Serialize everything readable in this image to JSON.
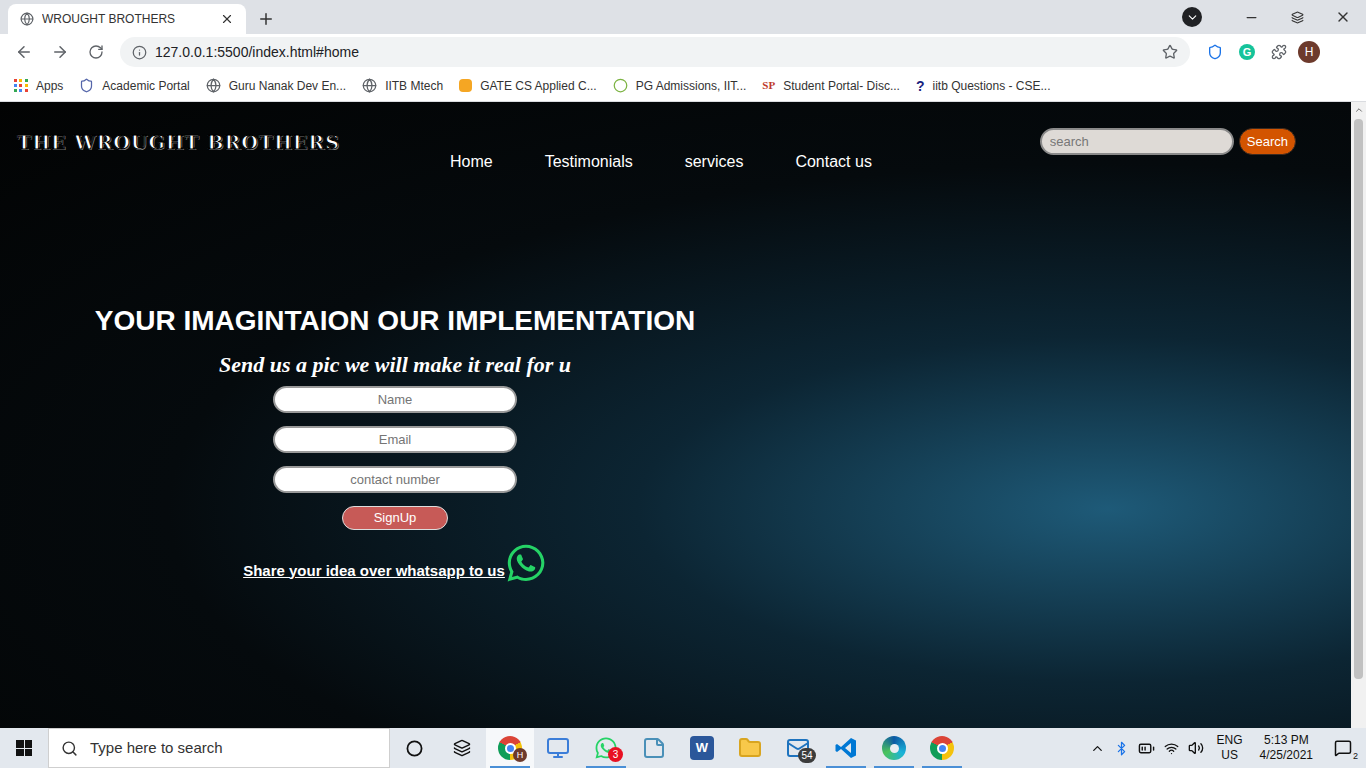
{
  "browser": {
    "tabs": [
      {
        "title": "WROUGHT BROTHERS",
        "selected": true
      }
    ],
    "address": "127.0.0.1:5500/index.html#home",
    "bookmarked": false,
    "extensions": [
      {
        "kind": "shield"
      },
      {
        "kind": "letter",
        "icon_text": "G"
      },
      {
        "kind": "puzzle"
      }
    ],
    "profile": "H",
    "bookmarks": [
      {
        "label": "Apps",
        "kind": "apps"
      },
      {
        "label": "Academic Portal",
        "kind": "crest"
      },
      {
        "label": "Guru Nanak Dev En...",
        "kind": "globe"
      },
      {
        "label": "IITB Mtech",
        "kind": "globe"
      },
      {
        "label": "GATE CS Applied C...",
        "kind": "arrow"
      },
      {
        "label": "PG Admissions, IIT...",
        "kind": "leaf"
      },
      {
        "label": "Student Portal- Disc...",
        "kind": "monogram",
        "icon_text": "SP"
      },
      {
        "label": "iitb Questions - CSE...",
        "kind": "question",
        "icon_text": "?"
      }
    ]
  },
  "page": {
    "logo": "THE WROUGHT BROTHERS",
    "nav": [
      "Home",
      "Testimonials",
      "services",
      "Contact us"
    ],
    "search": {
      "placeholder": "search",
      "button": "Search"
    },
    "headline": "YOUR IMAGINTAION OUR IMPLEMENTATION",
    "subtitle": "Send us a pic we will make it real for u",
    "form": {
      "fields": [
        {
          "placeholder": "Name"
        },
        {
          "placeholder": "Email"
        },
        {
          "placeholder": "contact number"
        }
      ],
      "button": "SignUp"
    },
    "whatsapp_link": "Share your idea over whatsapp to us"
  },
  "taskbar": {
    "search_placeholder": "Type here to search",
    "apps": [
      {
        "kind": "chrome",
        "badge": "H",
        "running": true,
        "selected": true
      },
      {
        "kind": "laptop",
        "running": false,
        "selected": false
      },
      {
        "kind": "whatsapp",
        "badge": "3",
        "running": true,
        "selected": false
      },
      {
        "kind": "notes",
        "running": false,
        "selected": false
      },
      {
        "kind": "word",
        "icon_text": "W",
        "running": false,
        "selected": false
      },
      {
        "kind": "folder",
        "running": false,
        "selected": false
      },
      {
        "kind": "mail",
        "badge": "54",
        "running": false,
        "selected": false
      },
      {
        "kind": "vscode",
        "running": true,
        "selected": false
      },
      {
        "kind": "edge",
        "running": true,
        "selected": false
      },
      {
        "kind": "chrome",
        "running": true,
        "selected": false
      }
    ],
    "tray": {
      "language": "ENG",
      "region": "US",
      "time": "5:13 PM",
      "date": "4/25/2021",
      "notifications": "2"
    }
  }
}
